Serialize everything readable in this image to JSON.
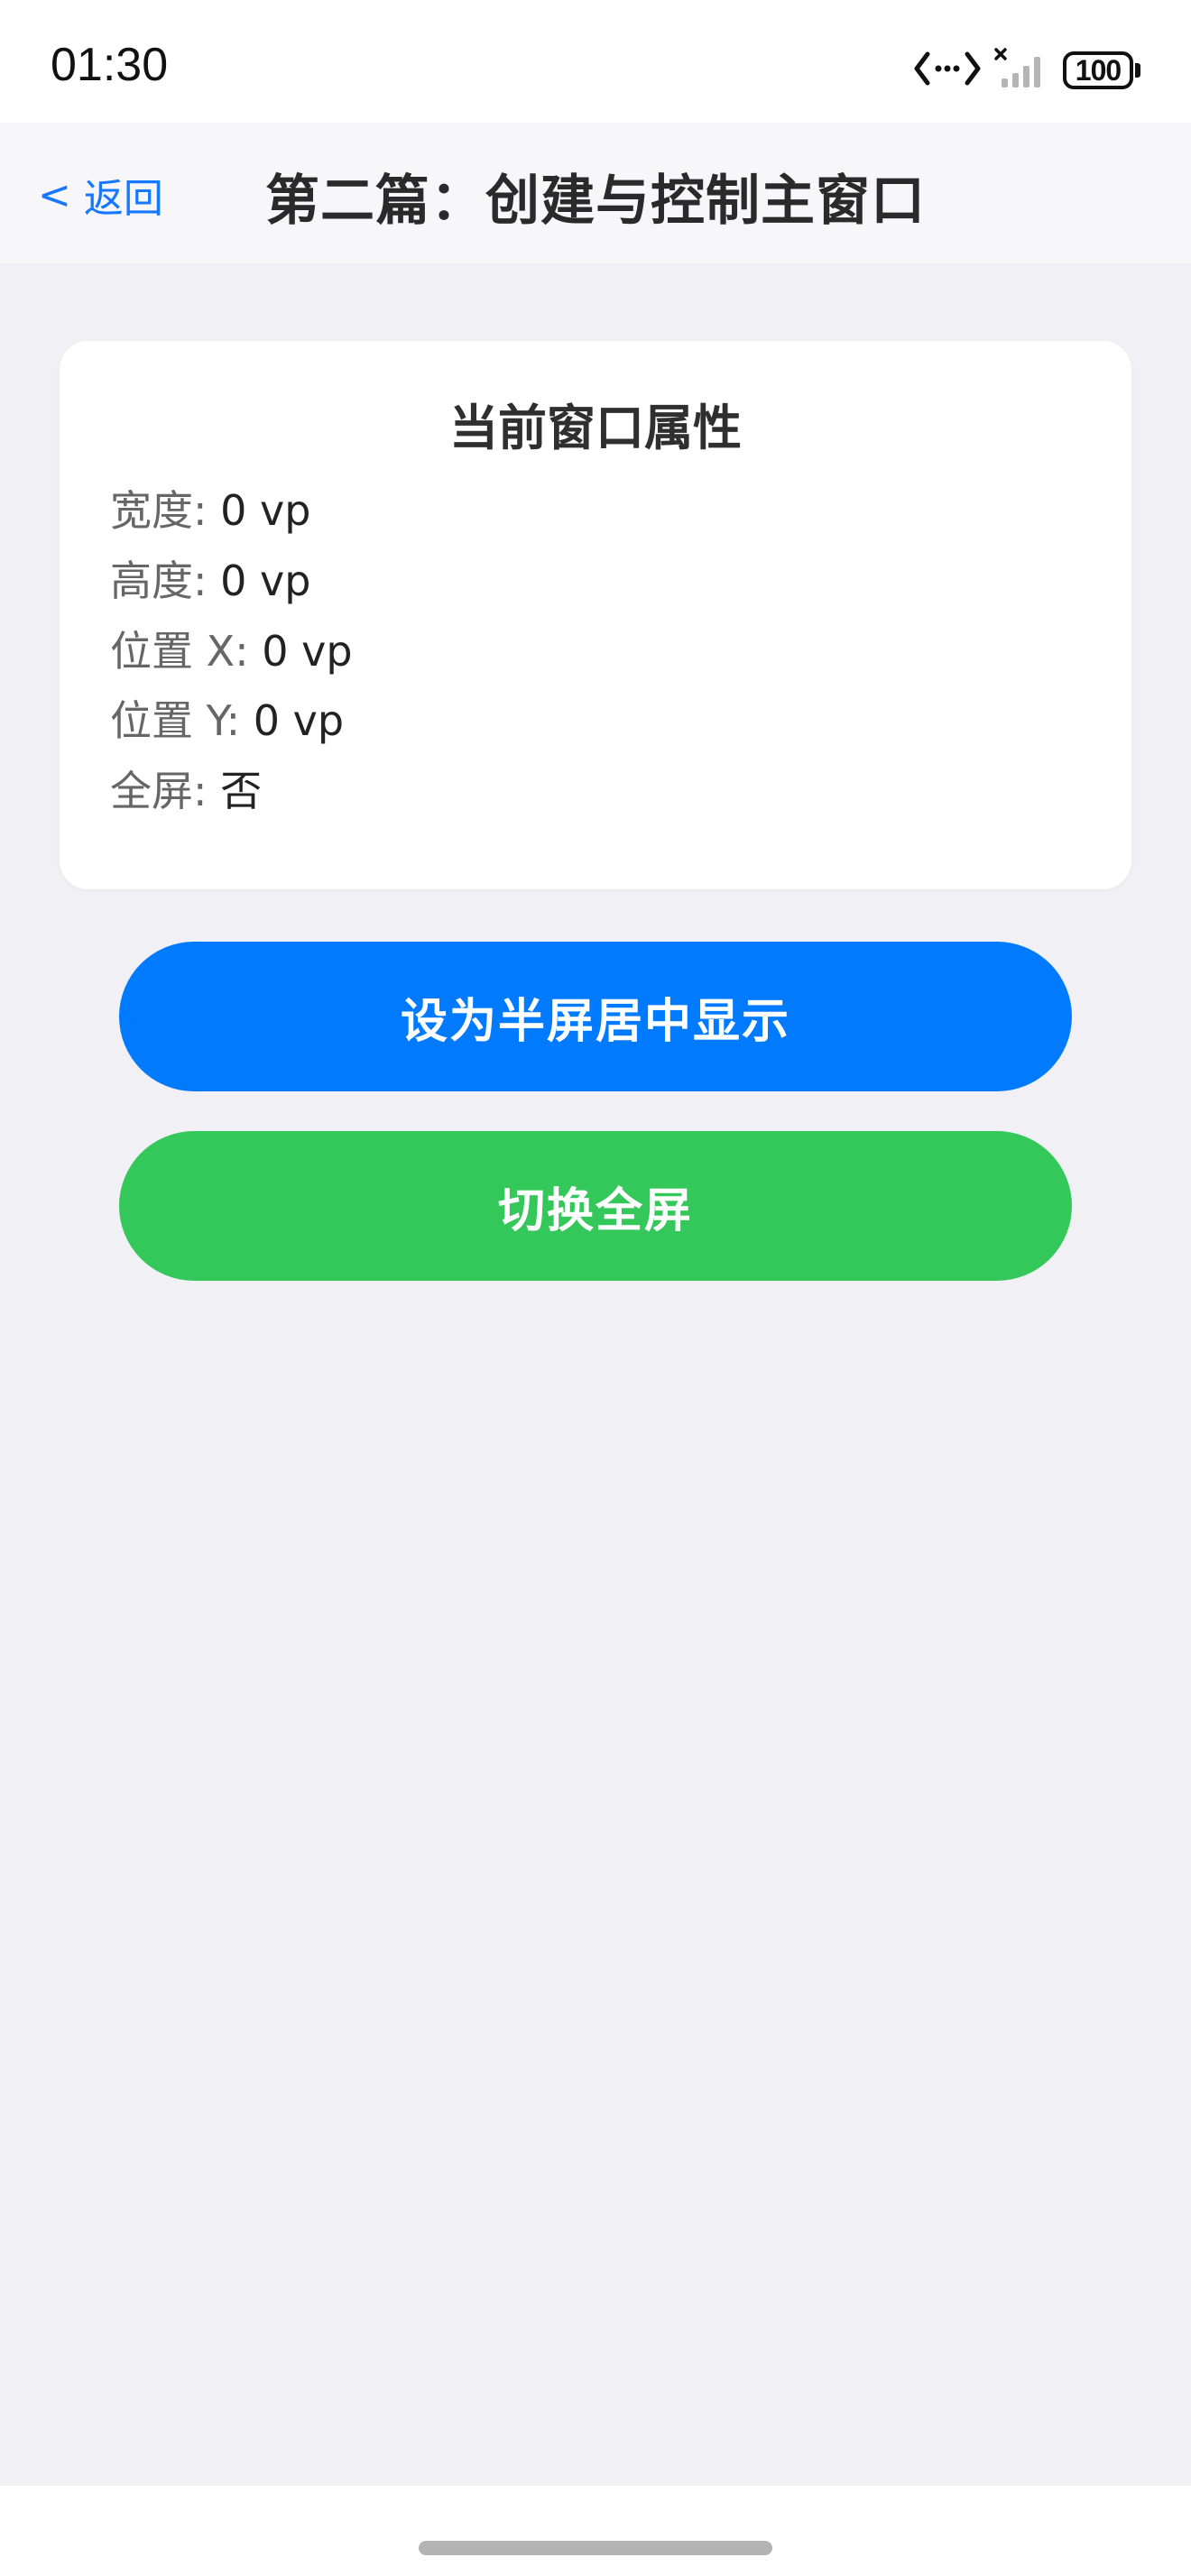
{
  "status_bar": {
    "time": "01:30",
    "battery": "100",
    "icons": [
      "code-arrows-icon",
      "no-signal-icon",
      "battery-icon"
    ]
  },
  "nav": {
    "back_arrow": "<",
    "back_label": "返回",
    "title": "第二篇：创建与控制主窗口"
  },
  "card": {
    "title": "当前窗口属性",
    "rows": [
      {
        "label": "宽度: ",
        "value": "0 vp"
      },
      {
        "label": "高度: ",
        "value": "0 vp"
      },
      {
        "label": "位置 X: ",
        "value": "0 vp"
      },
      {
        "label": "位置 Y: ",
        "value": "0 vp"
      },
      {
        "label": "全屏: ",
        "value": "否"
      }
    ]
  },
  "buttons": {
    "half_screen_label": "设为半屏居中显示",
    "toggle_fullscreen_label": "切换全屏"
  },
  "colors": {
    "accent_blue": "#007aff",
    "accent_green": "#34c85a",
    "link_blue": "#1677ff",
    "page_background": "#f1f1f5"
  }
}
